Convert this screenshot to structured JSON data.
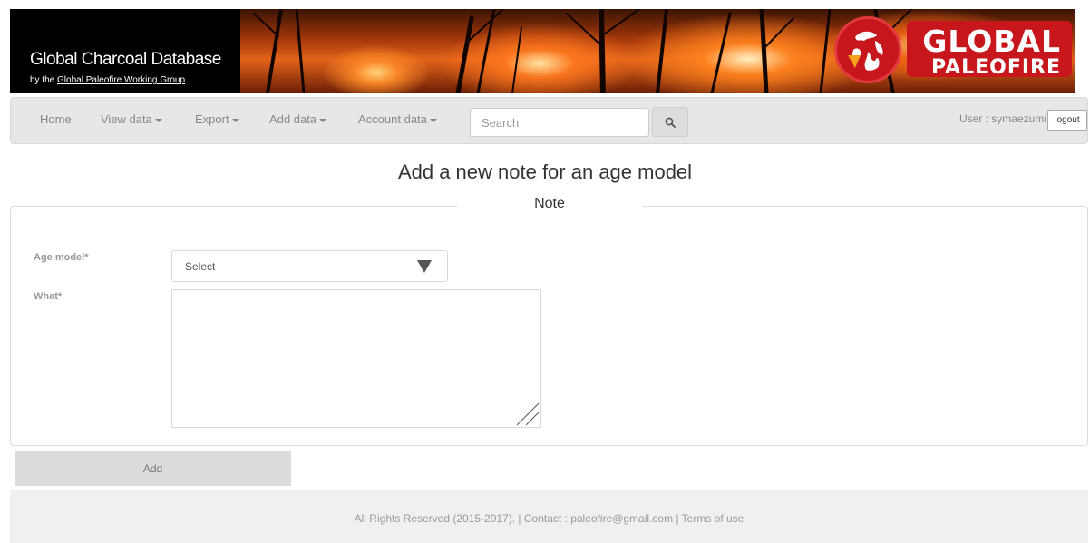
{
  "banner": {
    "title": "Global Charcoal Database",
    "subtitle_prefix": "by the",
    "subtitle_link": "Global Paleofire Working Group",
    "logo_line1": "GLOBAL",
    "logo_line2": "PALEOFIRE"
  },
  "nav": {
    "home": "Home",
    "view_data": "View data",
    "export": "Export",
    "add_data": "Add data",
    "account_data": "Account data",
    "search_placeholder": "Search",
    "search_icon": "search-icon",
    "user_label": "User : symaezumi",
    "logout": "logout"
  },
  "page": {
    "title": "Add a new note for an age model",
    "legend": "Note"
  },
  "form": {
    "age_model_label": "Age model*",
    "age_model_value": "Select",
    "what_label": "What*",
    "what_value": "",
    "add_button": "Add"
  },
  "footer": {
    "text": "All Rights Reserved (2015-2017). | Contact : paleofire@gmail.com | Terms of use"
  },
  "colors": {
    "logo_red": "#c8161d",
    "navbar_bg": "#e7e7e7",
    "button_bg": "#dcdcdc"
  }
}
